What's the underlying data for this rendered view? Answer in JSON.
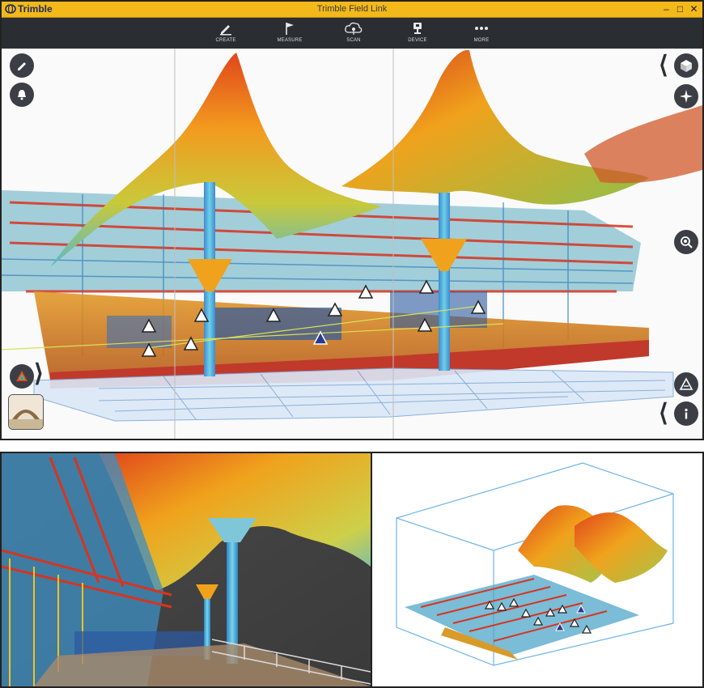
{
  "app": {
    "window_title": "Trimble Field Link",
    "logo_text": "Trimble",
    "window_controls": [
      "–",
      "□",
      "✕"
    ]
  },
  "toolbar": {
    "items": [
      {
        "label": "CREATE",
        "icon": "pencil-plus-icon"
      },
      {
        "label": "MEASURE",
        "icon": "flag-icon"
      },
      {
        "label": "SCAN",
        "icon": "cloud-scan-icon"
      },
      {
        "label": "DEVICE",
        "icon": "total-station-icon"
      },
      {
        "label": "MORE",
        "icon": "more-dots-icon"
      }
    ]
  },
  "left_buttons": [
    {
      "icon": "pencil-icon"
    },
    {
      "icon": "bell-icon"
    },
    {
      "icon": "color-wheel-icon"
    }
  ],
  "right_buttons": [
    {
      "icon": "cube-view-icon"
    },
    {
      "icon": "compass-icon"
    },
    {
      "icon": "zoom-icon"
    },
    {
      "icon": "layers-triangle-icon"
    },
    {
      "icon": "info-icon"
    }
  ],
  "colors": {
    "title_bar": "#f3b81a",
    "toolbar": "#2a2d31",
    "button_bg": "#3b3f45",
    "scan_hot": "#d8341e",
    "scan_warm": "#f0a21c",
    "scan_cool": "#4fb6d8"
  }
}
